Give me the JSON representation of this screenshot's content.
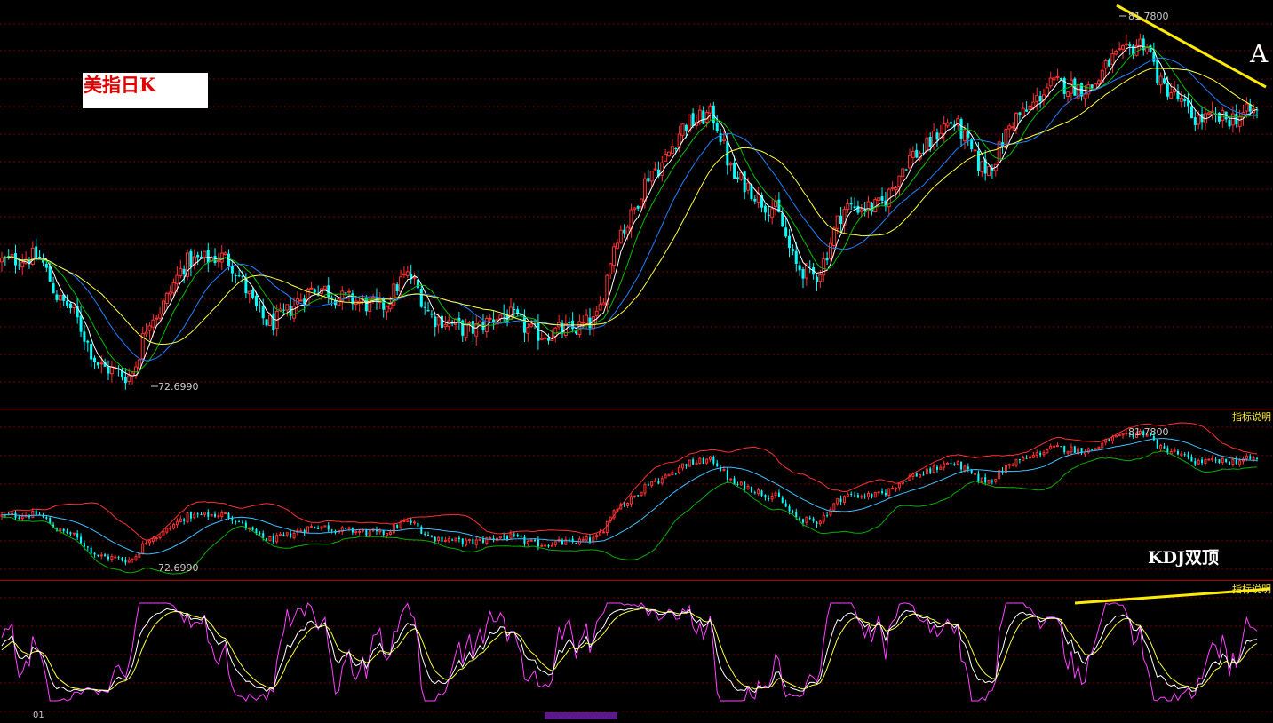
{
  "chart_title": "美指日K",
  "label_a": "A",
  "label_kdj": "KDJ双顶",
  "indicator_button": "指标说明",
  "annotations": {
    "high": "81.7800",
    "low": "72.6990"
  },
  "colors": {
    "up": "#ff3030",
    "down": "#00ffff",
    "ma1": "#ffffff",
    "ma2": "#ffff40",
    "ma3": "#00c000",
    "ma4": "#2080ff",
    "boll_up": "#ff3030",
    "boll_mid": "#40c0ff",
    "boll_low": "#00b000",
    "k": "#ffffff",
    "d": "#ffff40",
    "j": "#ff40ff",
    "trend": "#ffeb00",
    "grid": "#7a0000"
  },
  "chart_data": [
    {
      "type": "candlestick",
      "title": "美指日K",
      "ylim": [
        72.0,
        82.6
      ],
      "grid": true,
      "annotations": [
        {
          "text": "81.7800",
          "value": 81.78,
          "kind": "max"
        },
        {
          "text": "72.6990",
          "value": 72.699,
          "kind": "min"
        }
      ],
      "anchors": [
        [
          0,
          75.8
        ],
        [
          10,
          75.9
        ],
        [
          18,
          74.7
        ],
        [
          30,
          73.0
        ],
        [
          37,
          72.8
        ],
        [
          44,
          74.4
        ],
        [
          55,
          75.8
        ],
        [
          64,
          75.9
        ],
        [
          78,
          74.2
        ],
        [
          92,
          75.1
        ],
        [
          100,
          74.8
        ],
        [
          110,
          74.6
        ],
        [
          118,
          75.4
        ],
        [
          126,
          74.3
        ],
        [
          136,
          74.0
        ],
        [
          146,
          74.4
        ],
        [
          156,
          73.9
        ],
        [
          165,
          74.0
        ],
        [
          172,
          74.2
        ],
        [
          180,
          76.6
        ],
        [
          190,
          78.2
        ],
        [
          200,
          79.4
        ],
        [
          206,
          79.6
        ],
        [
          214,
          77.9
        ],
        [
          224,
          77.2
        ],
        [
          232,
          75.6
        ],
        [
          236,
          75.4
        ],
        [
          246,
          77.2
        ],
        [
          254,
          77.2
        ],
        [
          266,
          78.6
        ],
        [
          276,
          79.4
        ],
        [
          286,
          78.2
        ],
        [
          296,
          79.6
        ],
        [
          306,
          80.4
        ],
        [
          316,
          80.3
        ],
        [
          324,
          81.1
        ],
        [
          332,
          81.5
        ],
        [
          338,
          80.3
        ],
        [
          348,
          79.5
        ],
        [
          356,
          79.5
        ],
        [
          365,
          79.7
        ]
      ],
      "overlays": [
        "MA",
        "MA",
        "MA",
        "MA"
      ]
    },
    {
      "type": "candlestick-bollinger",
      "title": "",
      "ylim": [
        71.5,
        83.0
      ],
      "series": [
        "upper",
        "middle",
        "lower"
      ],
      "annotations": [
        {
          "text": "81.7800",
          "value": 81.78,
          "kind": "max"
        },
        {
          "text": "72.6990",
          "value": 72.699,
          "kind": "min"
        }
      ]
    },
    {
      "type": "line",
      "title": "",
      "series": [
        "K",
        "D",
        "J"
      ],
      "ylim": [
        -10,
        110
      ],
      "annotation": "KDJ双顶"
    }
  ]
}
